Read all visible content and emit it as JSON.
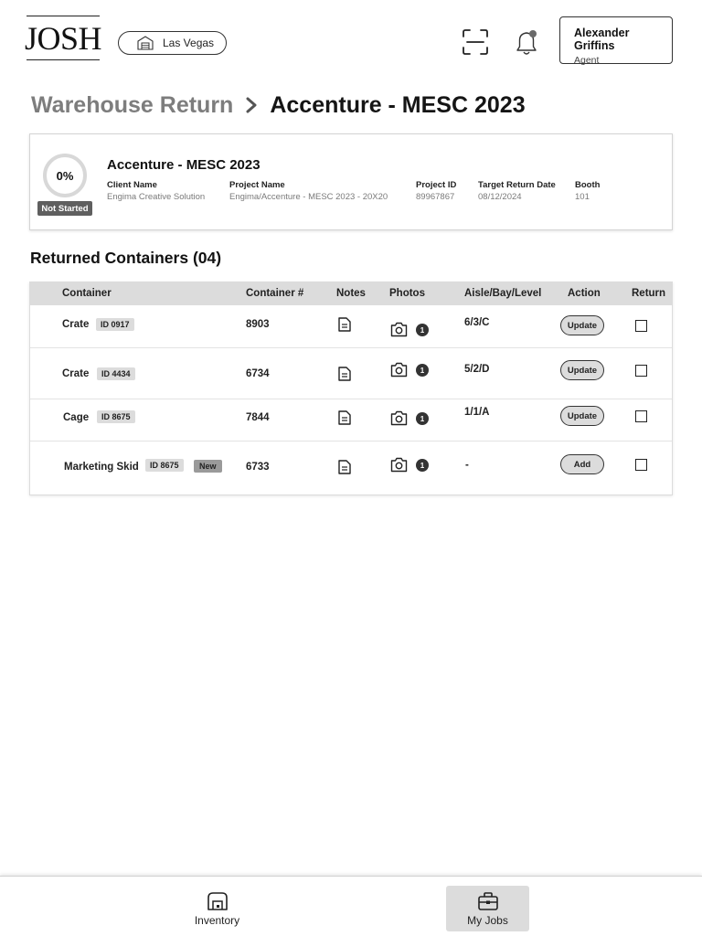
{
  "app": {
    "logo": "JOSH"
  },
  "header": {
    "location": "Las Vegas",
    "user": {
      "name": "Alexander Griffins",
      "role": "Agent"
    },
    "icons": {
      "scan": "scan-icon",
      "notifications": "bell-icon",
      "location": "warehouse-icon"
    }
  },
  "breadcrumb": {
    "parent": "Warehouse Return",
    "current": "Accenture - MESC 2023"
  },
  "project": {
    "progress_percent": 0,
    "progress_label": "0%",
    "status": "Not Started",
    "title": "Accenture - MESC 2023",
    "fields": [
      {
        "label": "Client Name",
        "value": "Engima Creative Solution"
      },
      {
        "label": "Project Name",
        "value": "Engima/Accenture - MESC 2023 - 20X20"
      },
      {
        "label": "Project ID",
        "value": "89967867"
      },
      {
        "label": "Target Return Date",
        "value": "08/12/2024"
      },
      {
        "label": "Booth",
        "value": "101"
      }
    ]
  },
  "containers": {
    "title": "Returned Containers (04)",
    "columns": [
      "Container",
      "Container #",
      "Notes",
      "Photos",
      "Aisle/Bay/Level",
      "Action",
      "Return"
    ],
    "rows": [
      {
        "name": "Crate",
        "id": "ID 0917",
        "tag": "",
        "number": "8903",
        "photo_count": "1",
        "location": "6/3/C",
        "action": "Update",
        "returned": false
      },
      {
        "name": "Crate",
        "id": "ID 4434",
        "tag": "",
        "number": "6734",
        "photo_count": "1",
        "location": "5/2/D",
        "action": "Update",
        "returned": false
      },
      {
        "name": "Cage",
        "id": "ID 8675",
        "tag": "",
        "number": "7844",
        "photo_count": "1",
        "location": "1/1/A",
        "action": "Update",
        "returned": false
      },
      {
        "name": "Marketing Skid",
        "id": "ID 8675",
        "tag": "New",
        "number": "6733",
        "photo_count": "1",
        "location": "-",
        "action": "Add",
        "returned": false
      }
    ]
  },
  "nav": {
    "items": [
      {
        "label": "Inventory",
        "icon": "warehouse-icon",
        "active": false
      },
      {
        "label": "My Jobs",
        "icon": "briefcase-icon",
        "active": true
      }
    ]
  },
  "colors": {
    "badge_dark": "#5f5f5f",
    "header_row": "#dcdcdc",
    "muted_text": "#7a7a7a"
  }
}
